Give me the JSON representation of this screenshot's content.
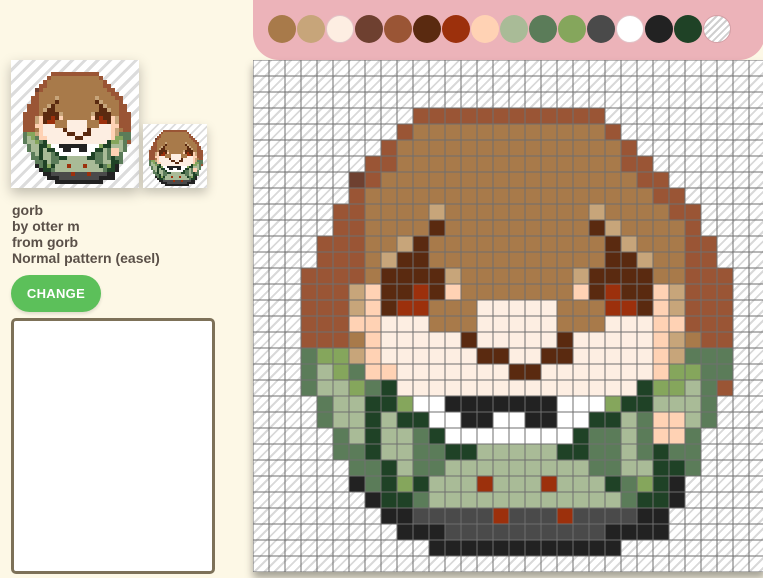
{
  "pattern": {
    "title": "gorb",
    "author": "by otter m",
    "from": "from gorb",
    "type": "Normal pattern (easel)"
  },
  "actions": {
    "change_label": "CHANGE"
  },
  "notes_field": {
    "value": "",
    "placeholder": ""
  },
  "palette": {
    "swatches": [
      {
        "name": "palette-swatch-1",
        "color": "#a87a4a"
      },
      {
        "name": "palette-swatch-2",
        "color": "#c7a57a"
      },
      {
        "name": "palette-swatch-3",
        "color": "#fdeee2"
      },
      {
        "name": "palette-swatch-4",
        "color": "#6e4030"
      },
      {
        "name": "palette-swatch-5",
        "color": "#9a5535"
      },
      {
        "name": "palette-swatch-6",
        "color": "#5a2a10"
      },
      {
        "name": "palette-swatch-7",
        "color": "#9c300c"
      },
      {
        "name": "palette-swatch-8",
        "color": "#ffd2b4"
      },
      {
        "name": "palette-swatch-9",
        "color": "#a9bb97"
      },
      {
        "name": "palette-swatch-10",
        "color": "#5b7c59"
      },
      {
        "name": "palette-swatch-11",
        "color": "#85a65c"
      },
      {
        "name": "palette-swatch-12",
        "color": "#4a4a4a"
      },
      {
        "name": "palette-swatch-13",
        "color": "#ffffff"
      },
      {
        "name": "palette-swatch-14",
        "color": "#222222"
      },
      {
        "name": "palette-swatch-15",
        "color": "#1f4226"
      },
      {
        "name": "palette-swatch-transparent",
        "color": "transparent"
      }
    ]
  },
  "pixel_art": {
    "grid_size": 32,
    "key": {
      "A": "#a87a4a",
      "B": "#c7a57a",
      "C": "#fdeee2",
      "D": "#6e4030",
      "E": "#9a5535",
      "F": "#5a2a10",
      "G": "#9c300c",
      "H": "#ffd2b4",
      "I": "#a9bb97",
      "J": "#5b7c59",
      "K": "#85a65c",
      "L": "#4a4a4a",
      "M": "#ffffff",
      "N": "#222222",
      "O": "#1f4226"
    },
    "rows": [
      "................................",
      "................................",
      "................................",
      "..........EEEEEEEEEEEE..........",
      ".........EAAAAAAAAAAAAE.........",
      "........EAAAAAAAAAAAAAAE.........",
      ".......EEAAAAAAAAAAAAAAEE........",
      "......DEAAAAAAAAAAAAAAAAEE.......",
      "......EAAAAAAAAAAAAAAAAAAEE......",
      ".....EEAAAABAAAAAAAAABAAAAEE.....",
      ".....EEAAAAFAAAAAAAAAFBAAAAE.....",
      "....EEEAABFAAAAAAAAAAAFBAAAEE....",
      "....EEEABFFAAAAAAAAAAAFFBAAEE....",
      "...EEEEAFFFFBAAAAAAABFFFFAAEEE...",
      "...EEEBHFFGFHAAAAAAAHFGFFHBEEE...",
      "...EEEBHFGGAAACCCCCAAAGGFHBEEE...",
      "...EEEHHCCCAAACCCCCAAACCCHHEEE...",
      "...EEEAHCCCCCFCCCCCFCCCCCHBAEE...",
      "...JKKBHCCCCCCFFCCFFCCCCCHBJJJ...",
      "...JIKJHHCCCCCCCFFCCCCCCCHKKJJ...",
      "...JIIKJOCCCCCCCCCCCCCCCOKKIJE...",
      "....JIIOOKMMNNNNNNNMMMKOOIIIJ....",
      "....JIIOIOOMMNNMMNNMMOOIJHHIJ....",
      ".....JIOIIJOMMMMMMMMOJJIJHHJ.....",
      ".....JJOIIJJOOIIIIIOOJJIJOJJ.....",
      "......JJOIJJIIIIIIIIIJJIIOOJ.....",
      "......NJOKOIIIGIIIGIIIOJKON......",
      ".......NOOJIIIIIIIIIIIIJOON......",
      "........NNLLLLLGLLLGLLLLNN.......",
      ".........NNNLLLLLLLLLLNNNN.......",
      "...........NNNNNNNNNNNN.........",
      "................................"
    ]
  }
}
